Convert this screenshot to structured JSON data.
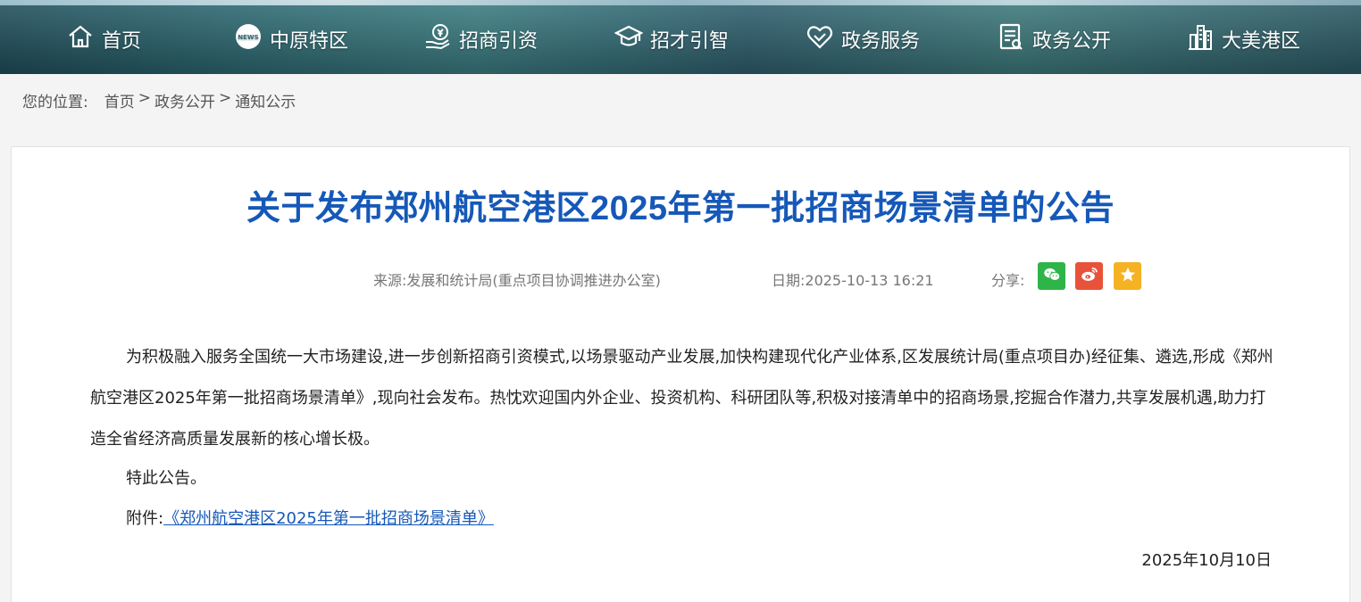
{
  "nav": {
    "items": [
      {
        "label": "首页",
        "icon": "home-icon"
      },
      {
        "label": "中原特区",
        "icon": "news-globe-icon"
      },
      {
        "label": "招商引资",
        "icon": "yuan-hand-icon"
      },
      {
        "label": "招才引智",
        "icon": "graduation-cap-icon"
      },
      {
        "label": "政务服务",
        "icon": "heart-hands-icon"
      },
      {
        "label": "政务公开",
        "icon": "document-icon"
      },
      {
        "label": "大美港区",
        "icon": "buildings-icon"
      }
    ]
  },
  "breadcrumb": {
    "prefix": "您的位置:",
    "items": [
      "首页",
      "政务公开",
      "通知公示"
    ],
    "separator": ">"
  },
  "article": {
    "title": "关于发布郑州航空港区2025年第一批招商场景清单的公告",
    "source": "来源:发展和统计局(重点项目协调推进办公室)",
    "date": "日期:2025-10-13 16:21",
    "share_label": "分享:",
    "paragraph1": "为积极融入服务全国统一大市场建设,进一步创新招商引资模式,以场景驱动产业发展,加快构建现代化产业体系,区发展统计局(重点项目办)经征集、遴选,形成《郑州航空港区2025年第一批招商场景清单》,现向社会发布。热忱欢迎国内外企业、投资机构、科研团队等,积极对接清单中的招商场景,挖掘合作潜力,共享发展机遇,助力打造全省经济高质量发展新的核心增长极。",
    "paragraph2": "特此公告。",
    "attachment_label": "附件:",
    "attachment_link": "《郑州航空港区2025年第一批招商场景清单》",
    "signature_date": "2025年10月10日"
  },
  "colors": {
    "title": "#1558b8",
    "wechat": "#2fb449",
    "weibo": "#e8523a",
    "favorite": "#f5b223"
  }
}
